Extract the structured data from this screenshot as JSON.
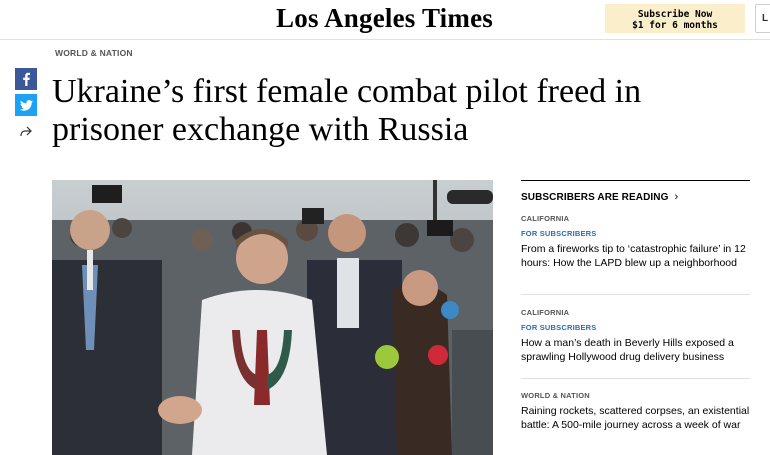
{
  "header": {
    "logo": "Los Angeles Times",
    "subscribe_line1": "Subscribe Now",
    "subscribe_line2": "$1 for 6 months",
    "login_partial": "L"
  },
  "article": {
    "section": "WORLD & NATION",
    "headline": "Ukraine’s first female combat pilot freed in prisoner exchange with Russia"
  },
  "share": {
    "facebook_icon": "facebook-icon",
    "twitter_icon": "twitter-icon",
    "share_icon": "share-arrow-icon"
  },
  "sidebar": {
    "title": "SUBSCRIBERS ARE READING",
    "chevron": "›",
    "items": [
      {
        "category": "CALIFORNIA",
        "label": "FOR SUBSCRIBERS",
        "title": "From a fireworks tip to ‘catastrophic failure’ in 12 hours: How the LAPD blew up a neighborhood"
      },
      {
        "category": "CALIFORNIA",
        "label": "FOR SUBSCRIBERS",
        "title": "How a man’s death in Beverly Hills exposed a sprawling Hollywood drug delivery business"
      },
      {
        "category": "WORLD & NATION",
        "title": "Raining rockets, scattered corpses, an existential battle: A 500-mile journey across a week of war"
      }
    ]
  },
  "colors": {
    "subscribe_bg": "#fbeeca",
    "facebook": "#3b5998",
    "twitter": "#1da1f2",
    "for_subscribers": "#2a6db5"
  }
}
